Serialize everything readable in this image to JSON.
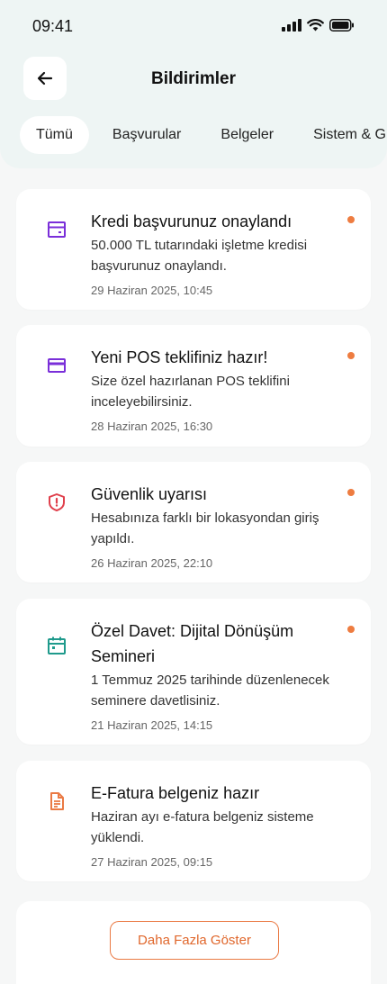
{
  "status_bar": {
    "time": "09:41"
  },
  "header": {
    "title": "Bildirimler"
  },
  "tabs": [
    {
      "label": "Tümü",
      "active": true
    },
    {
      "label": "Başvurular",
      "active": false
    },
    {
      "label": "Belgeler",
      "active": false
    },
    {
      "label": "Sistem & G",
      "active": false
    }
  ],
  "notifications": [
    {
      "icon": "credit-card-icon",
      "icon_color": "#7a2fd9",
      "title": "Kredi başvurunuz onaylandı",
      "message": "50.000 TL tutarındaki işletme kredisi başvurunuz onaylandı.",
      "date": "29 Haziran 2025, 10:45",
      "unread": true
    },
    {
      "icon": "pos-card-icon",
      "icon_color": "#7a2fd9",
      "title": "Yeni POS teklifiniz hazır!",
      "message": "Size özel hazırlanan POS teklifini inceleyebilirsiniz.",
      "date": "28 Haziran 2025, 16:30",
      "unread": true
    },
    {
      "icon": "shield-alert-icon",
      "icon_color": "#e0404c",
      "title": "Güvenlik uyarısı",
      "message": "Hesabınıza farklı bir lokasyondan giriş yapıldı.",
      "date": "26 Haziran 2025, 22:10",
      "unread": true
    },
    {
      "icon": "calendar-icon",
      "icon_color": "#1f9a8c",
      "title": "Özel Davet: Dijital Dönüşüm Semineri",
      "message": "1 Temmuz 2025 tarihinde düzenlenecek seminere davetlisiniz.",
      "date": "21 Haziran 2025, 14:15",
      "unread": true
    },
    {
      "icon": "document-icon",
      "icon_color": "#ea7a44",
      "title": "E-Fatura belgeniz hazır",
      "message": "Haziran ayı e-fatura belgeniz sisteme yüklendi.",
      "date": "27 Haziran 2025, 09:15",
      "unread": false
    }
  ],
  "load_more_label": "Daha Fazla Göster",
  "colors": {
    "accent": "#ea7a44",
    "unread_dot": "#ee7c40",
    "header_bg": "#eef5f4"
  }
}
